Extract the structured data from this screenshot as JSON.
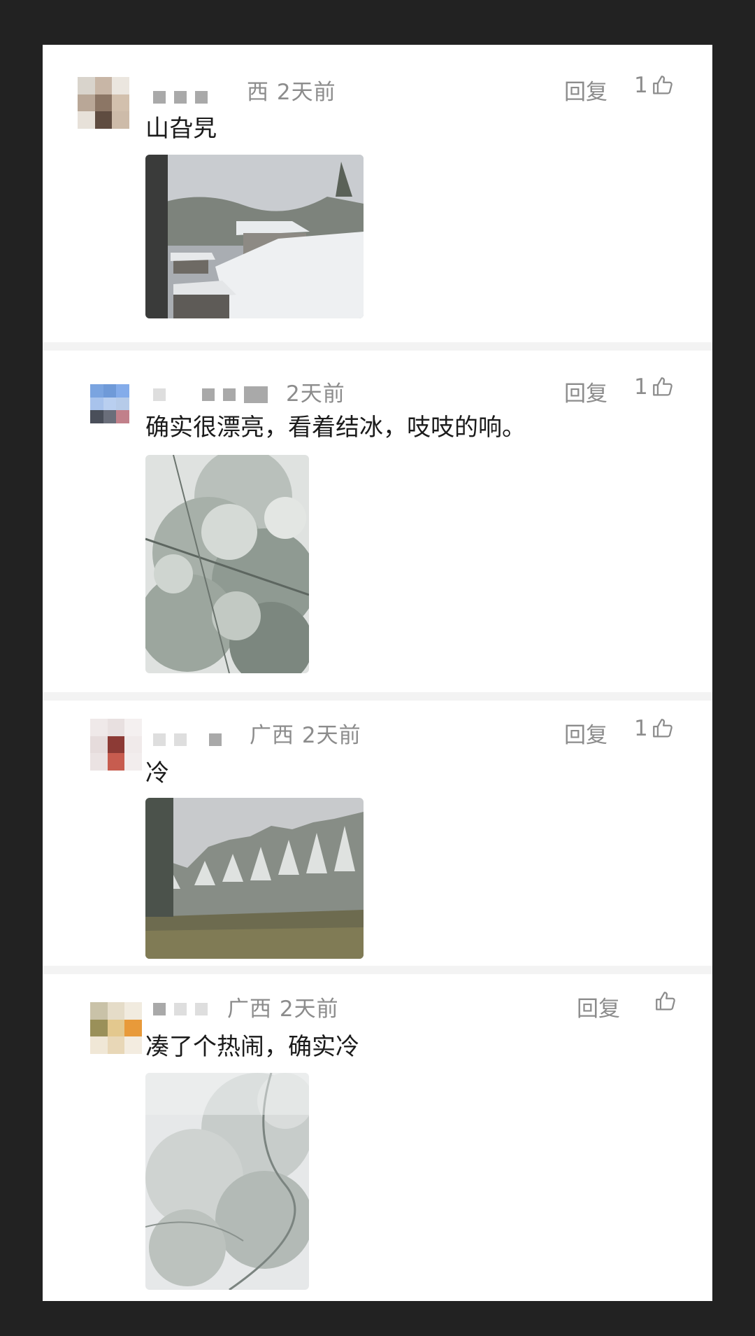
{
  "comments": [
    {
      "location_time": "西  2天前",
      "text": "山旮旯",
      "reply_label": "回复",
      "like_count": "1",
      "icon": "thumbs-up-icon",
      "photo": "snowy-village-rooftops"
    },
    {
      "location_time": "2天前",
      "text": "确实很漂亮，看着结冰，吱吱的响。",
      "reply_label": "回复",
      "like_count": "1",
      "icon": "thumbs-up-icon",
      "photo": "frosted-pine-branches"
    },
    {
      "location_time": "广西  2天前",
      "text": "冷",
      "reply_label": "回复",
      "like_count": "1",
      "icon": "thumbs-up-icon",
      "photo": "frosted-forest-hillside"
    },
    {
      "location_time": "广西  2天前",
      "text": "凑了个热闹，确实冷",
      "reply_label": "回复",
      "like_count": "",
      "icon": "thumbs-up-icon",
      "photo": "foggy-frosted-tree"
    }
  ],
  "colors": {
    "frame": "#222222",
    "card": "#ffffff",
    "meta_text": "#8c8c8c",
    "body_text": "#1b1b1b"
  }
}
